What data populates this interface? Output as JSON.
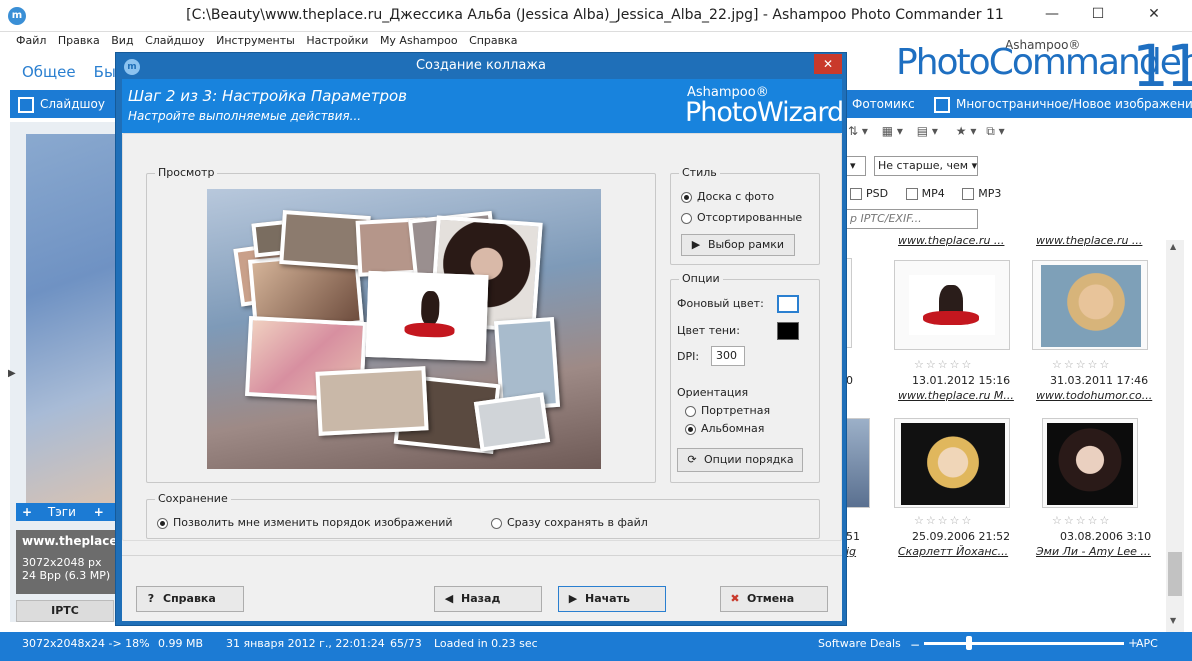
{
  "window": {
    "title": "[C:\\Beauty\\www.theplace.ru_Джессика Альба (Jessica Alba)_Jessica_Alba_22.jpg] - Ashampoo Photo Commander 11",
    "minimize": "—",
    "maximize": "☐",
    "close": "✕",
    "app_icon": "m"
  },
  "menu": [
    "Файл",
    "Правка",
    "Вид",
    "Слайдшоу",
    "Инструменты",
    "Настройки",
    "My Ashampoo",
    "Справка"
  ],
  "ribbon_tabs": [
    "Общее",
    "Быс"
  ],
  "logo": {
    "brand": "Ashampoo®",
    "name": "PhotoCommander",
    "version": "11"
  },
  "toolbar": {
    "slideshow": "Слайдшоу",
    "photomix": "Фотомикс",
    "multipage": "Многостраничное/Новое изображение"
  },
  "left_pane": {
    "tags_label": "Тэги",
    "file_name": "www.theplace.r",
    "dimensions": "3072x2048 px",
    "bit_depth": "24 Bpp (6.3 MP)",
    "iptc_tab": "IPTC"
  },
  "right_pane": {
    "filter_select": "Не старше, чем",
    "formats": [
      "PSD",
      "MP4",
      "MP3"
    ],
    "search_placeholder": "р IPTC/EXIF...",
    "top_sites": [
      "www.theplace.ru ...",
      "www.theplace.ru ..."
    ],
    "rows": [
      {
        "partial_date": "0",
        "items": [
          {
            "date": "13.01.2012 15:16",
            "site": "www.theplace.ru M..."
          },
          {
            "date": "31.03.2011 17:46",
            "site": "www.todohumor.co..."
          }
        ]
      },
      {
        "partial_date": "51",
        "partial_site": "ig",
        "items": [
          {
            "date": "25.09.2006 21:52",
            "site": "Скарлетт Йоханс..."
          },
          {
            "date": "03.08.2006 3:10",
            "site": "Эми Ли - Amy Lee ..."
          }
        ]
      }
    ]
  },
  "status": {
    "zoom": "3072x2048x24 -> 18%",
    "size": "0.99 MB",
    "date": "31 января 2012 г., 22:01:24",
    "index": "65/73",
    "load": "Loaded in 0.23 sec",
    "deals": "Software Deals",
    "apc": "APC"
  },
  "dialog": {
    "title": "Создание коллажа",
    "close": "✕",
    "step_title": "Шаг 2 из 3: Настройка Параметров",
    "step_subtitle": "Настройте выполняемые действия...",
    "wizard_brand": "Ashampoo®",
    "wizard_name": "PhotoWizard",
    "preview_label": "Просмотр",
    "style": {
      "label": "Стиль",
      "option_board": "Доска с фото",
      "option_sorted": "Отсортированные",
      "frame_button": "Выбор рамки"
    },
    "options": {
      "label": "Опции",
      "background_color_label": "Фоновый цвет:",
      "background_color": "#ffffff",
      "shadow_color_label": "Цвет тени:",
      "shadow_color": "#000000",
      "dpi_label": "DPI:",
      "dpi_value": "300",
      "orientation_label": "Ориентация",
      "portrait": "Портретная",
      "landscape": "Альбомная",
      "order_button": "Опции порядка"
    },
    "save": {
      "label": "Сохранение",
      "option_reorder": "Позволить мне изменить порядок изображений",
      "option_save_now": "Сразу сохранять в файл"
    },
    "buttons": {
      "help": "Справка",
      "back": "Назад",
      "start": "Начать",
      "cancel": "Отмена"
    }
  }
}
